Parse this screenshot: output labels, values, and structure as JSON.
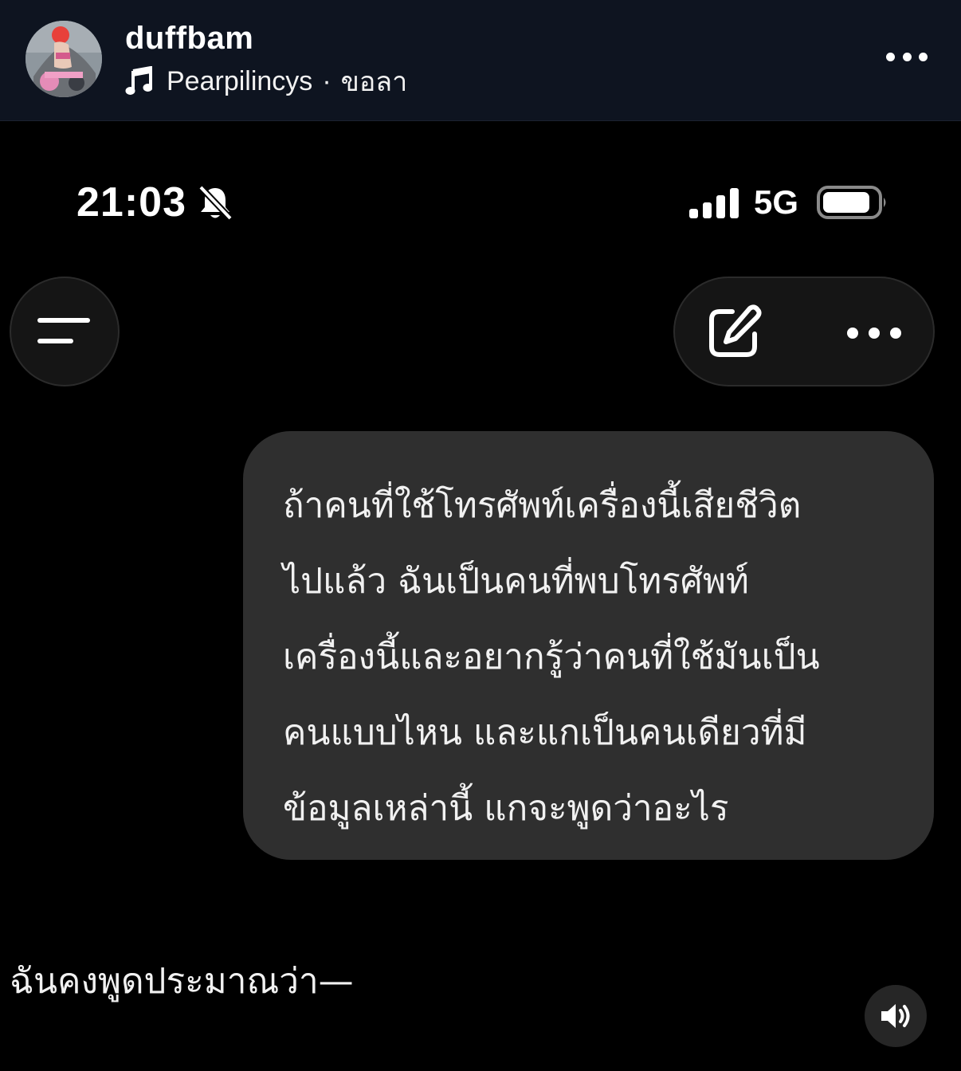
{
  "story_header": {
    "username": "duffbam",
    "music": {
      "icon": "music-note-icon",
      "artist": "Pearpilincys",
      "separator": "·",
      "song": "ขอลา"
    },
    "more_icon": "more-horizontal-icon"
  },
  "status_bar": {
    "time": "21:03",
    "silent_icon": "bell-slash-icon",
    "signal_icon": "cellular-signal-icon",
    "network": "5G",
    "battery_icon": "battery-icon"
  },
  "controls": {
    "menu_icon": "menu-icon",
    "compose_icon": "compose-icon",
    "more_icon": "more-horizontal-icon"
  },
  "chat": {
    "user_message": "ถ้าคนที่ใช้โทรศัพท์เครื่องนี้เสียชีวิต\nไปแล้ว ฉันเป็นคนที่พบโทรศัพท์\nเครื่องนี้และอยากรู้ว่าคนที่ใช้มันเป็น\nคนแบบไหน และแกเป็นคนเดียวที่มี\nข้อมูลเหล่านี้ แกจะพูดว่าอะไร",
    "assistant_message": "ฉันคงพูดประมาณว่า—"
  },
  "volume_icon": "speaker-icon",
  "colors": {
    "background": "#000000",
    "header_background": "#0e1420",
    "bubble": "#2f2f2f",
    "control_background": "#151515",
    "text": "#ffffff"
  }
}
